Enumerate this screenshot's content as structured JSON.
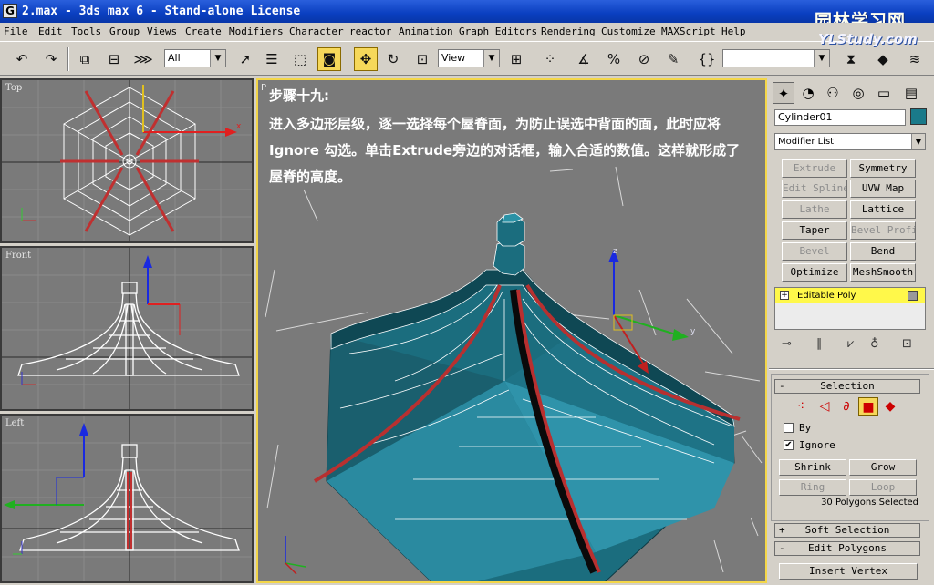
{
  "window": {
    "title": "2.max - 3ds max 6 - Stand-alone License",
    "app_icon": "G",
    "watermark_cn": "园林学习网",
    "watermark_en": "YLStudy.com"
  },
  "menu": [
    "File",
    "Edit",
    "Tools",
    "Group",
    "Views",
    "Create",
    "Modifiers",
    "Character",
    "reactor",
    "Animation",
    "Graph Editors",
    "Rendering",
    "Customize",
    "MAXScript",
    "Help"
  ],
  "toolbar": {
    "selection_filter": "All",
    "reference_coord": "View",
    "named_selection": ""
  },
  "viewports": {
    "top": "Top",
    "front": "Front",
    "left": "Left",
    "perspective": "P"
  },
  "instructions": {
    "title": "步骤十九:",
    "body": "进入多边形层级，逐一选择每个屋脊面，为防止误选中背面的面，此时应将Ignore 勾选。单击Extrude旁边的对话框，输入合适的数值。这样就形成了屋脊的高度。"
  },
  "command_panel": {
    "object_name": "Cylinder01",
    "object_color": "#1a7a8a",
    "modifier_list": "Modifier List",
    "modifier_buttons": [
      {
        "label": "Extrude",
        "enabled": false
      },
      {
        "label": "Symmetry",
        "enabled": true
      },
      {
        "label": "Edit Spline",
        "enabled": false
      },
      {
        "label": "UVW Map",
        "enabled": true
      },
      {
        "label": "Lathe",
        "enabled": false
      },
      {
        "label": "Lattice",
        "enabled": true
      },
      {
        "label": "Taper",
        "enabled": true
      },
      {
        "label": "Bevel Profile",
        "enabled": false
      },
      {
        "label": "Bevel",
        "enabled": false
      },
      {
        "label": "Bend",
        "enabled": true
      },
      {
        "label": "Optimize",
        "enabled": true
      },
      {
        "label": "MeshSmooth",
        "enabled": true
      }
    ],
    "stack_item": "Editable Poly",
    "stack_plus": "+",
    "selection_rollout": {
      "title": "Selection",
      "toggle": "-",
      "by_vertex": "By",
      "by_vertex_checked": false,
      "ignore_backfacing": "Ignore",
      "ignore_checked": true,
      "check_mark": "✔",
      "shrink": "Shrink",
      "grow": "Grow",
      "ring": "Ring",
      "loop": "Loop",
      "status": "30 Polygons Selected"
    },
    "soft_selection": {
      "title": "Soft Selection",
      "toggle": "+"
    },
    "edit_polygons": {
      "title": "Edit Polygons",
      "toggle": "-"
    },
    "insert_vertex": "Insert Vertex"
  },
  "axis_labels": {
    "x": "x",
    "y": "y",
    "z": "z"
  }
}
